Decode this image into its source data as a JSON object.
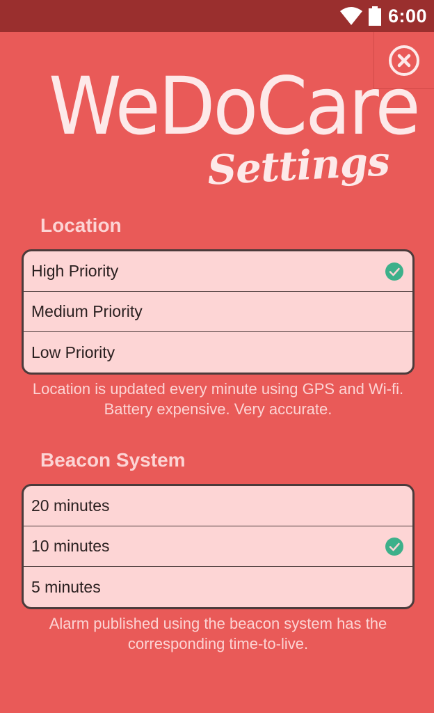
{
  "status_bar": {
    "time": "6:00",
    "wifi_icon": "wifi-icon",
    "battery_icon": "battery-icon"
  },
  "header": {
    "logo": "WeDoCare",
    "subtitle": "Settings",
    "close_icon": "close-circle-icon"
  },
  "location": {
    "title": "Location",
    "options": [
      {
        "label": "High Priority",
        "selected": true
      },
      {
        "label": "Medium Priority",
        "selected": false
      },
      {
        "label": "Low Priority",
        "selected": false
      }
    ],
    "note": "Location is updated every minute using GPS and Wi-fi. Battery expensive. Very accurate."
  },
  "beacon": {
    "title": "Beacon System",
    "options": [
      {
        "label": "20 minutes",
        "selected": false
      },
      {
        "label": "10 minutes",
        "selected": true
      },
      {
        "label": "5 minutes",
        "selected": false
      }
    ],
    "note": "Alarm published using the beacon system has the corresponding time-to-live."
  },
  "colors": {
    "background": "#e95a58",
    "status_bar": "#9a2f2e",
    "list_bg": "#fdd5d5",
    "check": "#3db08a"
  }
}
